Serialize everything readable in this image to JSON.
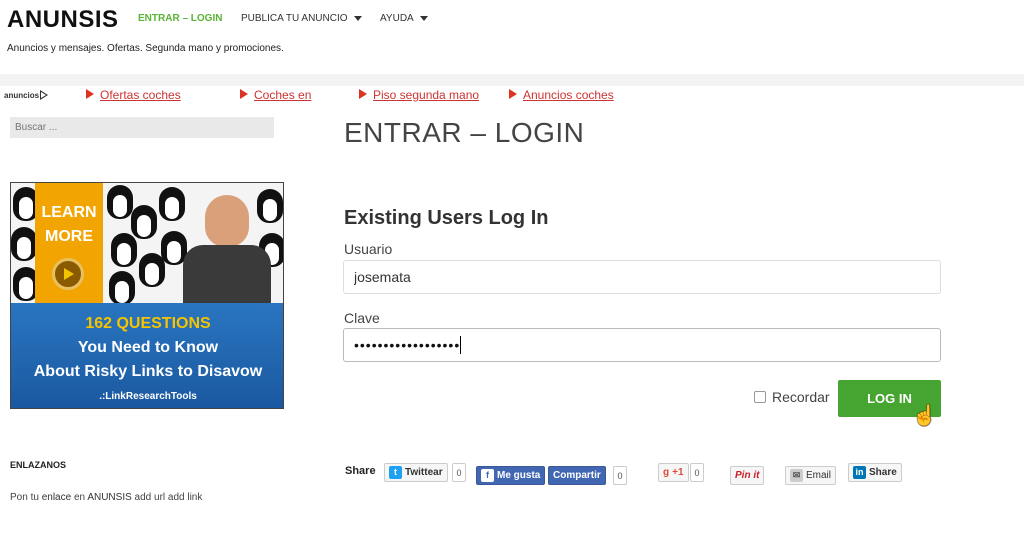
{
  "header": {
    "site_title": "ANUNSIS",
    "nav": [
      {
        "label": "ENTRAR – LOGIN",
        "active": true
      },
      {
        "label": "PUBLICA TU ANUNCIO",
        "dropdown": true
      },
      {
        "label": "AYUDA",
        "dropdown": true
      }
    ],
    "tagline": "Anuncios y mensajes. Ofertas. Segunda mano y promociones."
  },
  "ad_bar": {
    "label": "anuncios",
    "links": [
      "Ofertas coches",
      "Coches en",
      "Piso segunda mano",
      "Anuncios coches"
    ]
  },
  "sidebar": {
    "search_placeholder": "Buscar ...",
    "banner": {
      "learn_line1": "LEARN",
      "learn_line2": "MORE",
      "headline": "162 QUESTIONS",
      "line2": "You Need to Know",
      "line3": "About Risky Links to Disavow",
      "brand": ".:LinkResearchTools"
    },
    "section_heading": "ENLAZANOS",
    "section_text_prefix": "Pon tu ",
    "section_link1": "enlace",
    "section_mid": " en ",
    "section_link2": "ANUNSIS",
    "section_text_suffix": " add url add link"
  },
  "main": {
    "page_title": "ENTRAR – LOGIN",
    "login_heading": "Existing Users Log In",
    "username_label": "Usuario",
    "username_value": "josemata",
    "password_label": "Clave",
    "password_mask": "••••••••••••••••••",
    "remember_label": "Recordar",
    "login_button": "LOG IN"
  },
  "share": {
    "label": "Share",
    "twitter": "Twittear",
    "twitter_count": "0",
    "fb_like": "Me gusta",
    "fb_share": "Compartir",
    "fb_count": "0",
    "gplus": "+1",
    "gplus_count": "0",
    "pinterest": "Pin it",
    "email": "Email",
    "linkedin": "Share"
  },
  "colors": {
    "accent_green": "#5bb338",
    "button_green": "#46a531",
    "ad_link_red": "#c33",
    "facebook_blue": "#4267b2"
  }
}
